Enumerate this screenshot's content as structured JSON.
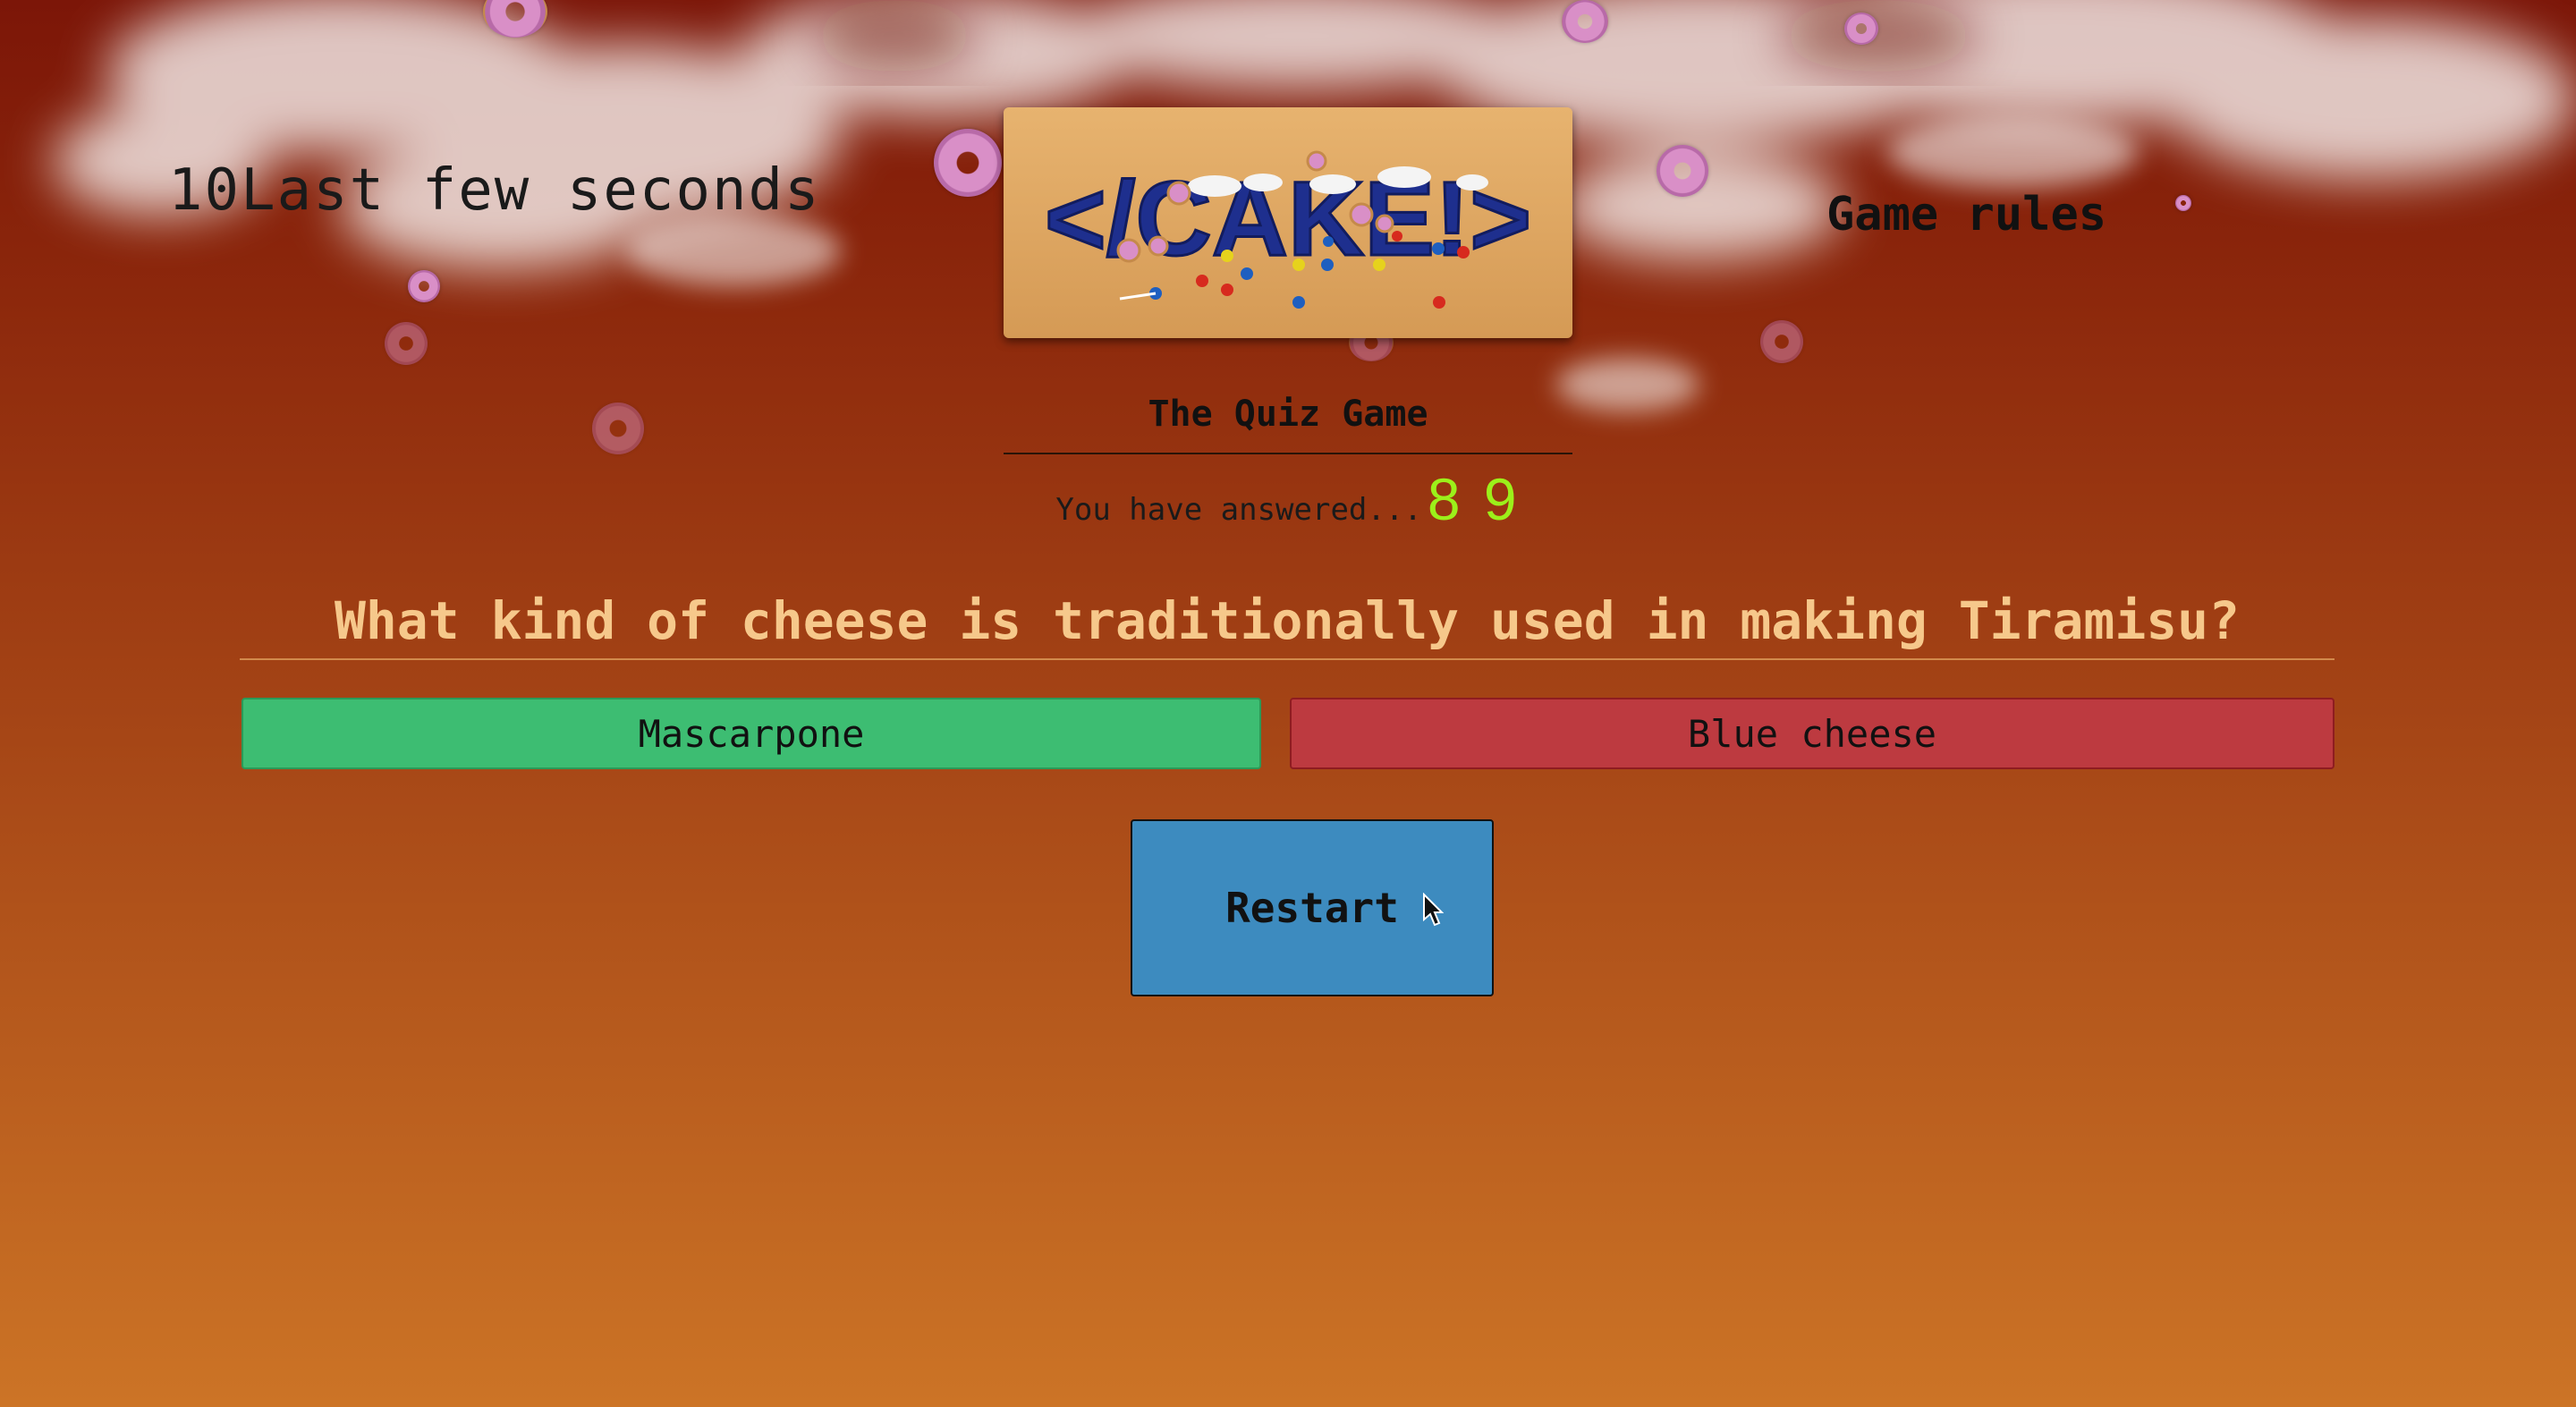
{
  "timer": {
    "seconds": "10",
    "label": "Last few seconds"
  },
  "rules_link": "Game rules",
  "logo": {
    "text": "</CAKE!>"
  },
  "game_title": "The Quiz Game",
  "progress": {
    "label": "You have answered...",
    "answered": "8",
    "total": "9"
  },
  "question": "What kind of cheese is traditionally used in making Tiramisu?",
  "answers": [
    {
      "label": "Mascarpone",
      "state": "correct"
    },
    {
      "label": "Blue cheese",
      "state": "wrong"
    }
  ],
  "restart_label": "Restart",
  "colors": {
    "correct": "#3dbd72",
    "wrong": "#bd3a40",
    "restart": "#3d8bbf",
    "question_text": "#f6c88b",
    "score_text": "#9cf01a"
  }
}
